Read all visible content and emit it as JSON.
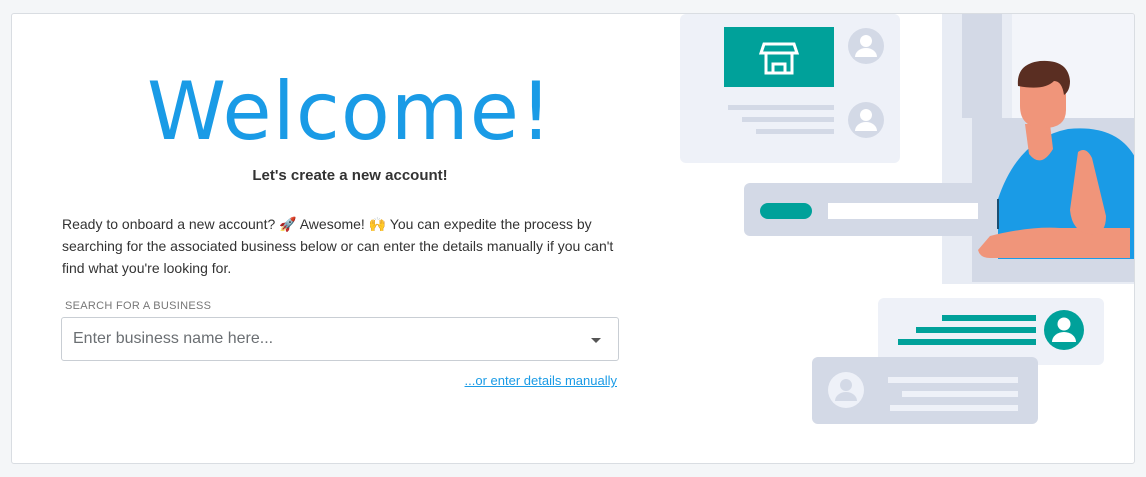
{
  "welcome": {
    "title": "Welcome!",
    "subtitle": "Let's create a new account!",
    "description_part1": "Ready to onboard a new account? ",
    "description_part2": " Awesome! ",
    "description_part3": " You can expedite the process by searching for the associated business below or can enter the details manually if you can't find what you're looking for.",
    "emoji_rocket": "🚀",
    "emoji_raised_hands": "🙌"
  },
  "search": {
    "label": "SEARCH FOR A BUSINESS",
    "placeholder": "Enter business name here...",
    "manual_link": "...or enter details manually"
  },
  "colors": {
    "accent": "#1a9be6",
    "teal": "#00a19a",
    "illustration_bg": "#eef1f8",
    "illustration_gray": "#d3d9e6"
  },
  "icons": [
    "storefront-icon",
    "user-avatar-icon",
    "chevron-down-icon"
  ]
}
